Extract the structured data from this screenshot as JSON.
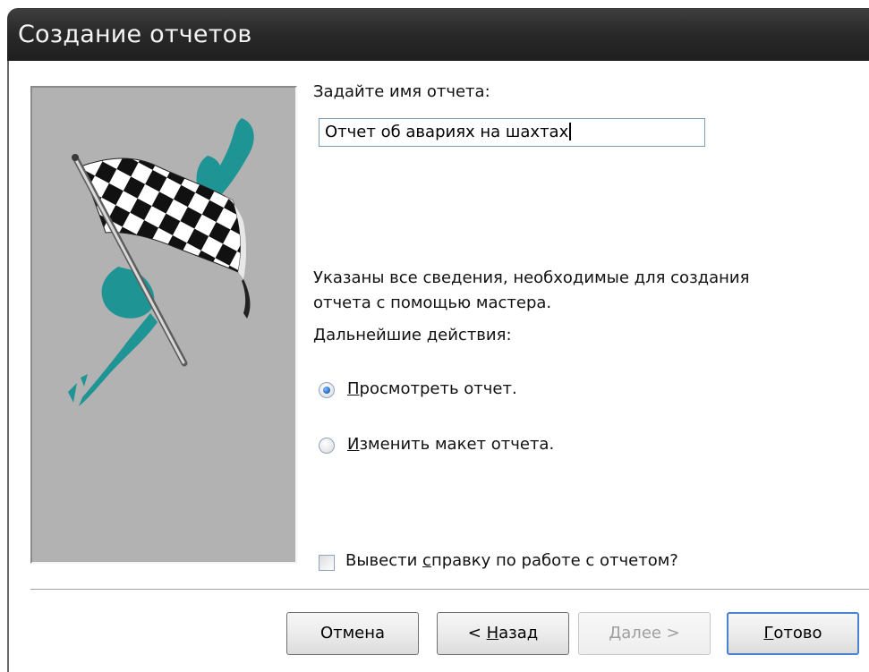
{
  "window": {
    "title": "Создание отчетов"
  },
  "form": {
    "name_prompt": "Задайте имя отчета:",
    "name_value": "Отчет об авариях на шахтах",
    "info_line1": "Указаны все сведения, необходимые для создания",
    "info_line2": "отчета с помощью мастера.",
    "next_actions": "Дальнейшие действия:",
    "options": [
      {
        "hotkey": "П",
        "rest": "росмотреть отчет.",
        "selected": true
      },
      {
        "hotkey": "И",
        "rest": "зменить макет отчета.",
        "selected": false
      }
    ],
    "help_check": {
      "before": "Вывести ",
      "hotkey": "с",
      "after": "правку по работе с отчетом?",
      "checked": false
    }
  },
  "buttons": {
    "cancel": {
      "label": "Отмена"
    },
    "back": {
      "prefix": "< ",
      "hotkey": "Н",
      "rest": "азад"
    },
    "next": {
      "label": "Далее >",
      "enabled": false
    },
    "finish": {
      "hotkey": "Г",
      "rest": "отово"
    }
  },
  "icons": {
    "wizard_image": "checkered-flag-icon"
  },
  "colors": {
    "accent_teal": "#1f9494",
    "titlebar": "#2a2a2a",
    "panel": "#b2b2b2"
  }
}
